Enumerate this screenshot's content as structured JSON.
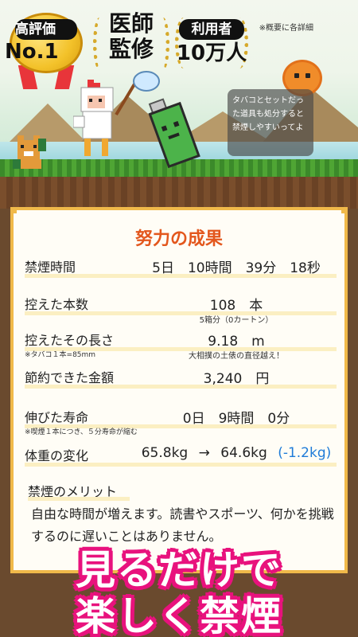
{
  "badges": {
    "rating": {
      "small": "高評価",
      "big": "No.1"
    },
    "medical": {
      "line1": "医師",
      "line2": "監修"
    },
    "users": {
      "small": "利用者",
      "big": "10万人"
    },
    "note": "※概要に各詳細"
  },
  "scene": {
    "speech": "タバコとセットだった道具も処分すると禁煙しやすいってよ",
    "icons": [
      "tiger-icon",
      "chicken-suit-character-icon",
      "net-icon",
      "lighter-character-icon",
      "sun-character-icon"
    ]
  },
  "card": {
    "title": "努力の成果",
    "rows": [
      {
        "label": "禁煙時間",
        "value": "5日　10時間　39分　18秒"
      },
      {
        "label": "控えた本数",
        "value": "108　本",
        "sub": "5箱分（0カートン）"
      },
      {
        "label": "控えたその長さ",
        "value": "9.18　m",
        "note": "※タバコ１本=85mm",
        "sub": "大相撲の土俵の直径越え！"
      },
      {
        "label": "節約できた金額",
        "value": "3,240　円"
      },
      {
        "label": "伸びた寿命",
        "value": "0日　9時間　0分",
        "note": "※喫煙１本につき、５分寿命が縮む"
      },
      {
        "label": "体重の変化",
        "value_from": "65.8kg",
        "arrow": "→",
        "value_to": "64.6kg",
        "diff": "(-1.2kg)"
      }
    ],
    "merit_title": "禁煙のメリット",
    "merit_text": "自由な時間が増えます。読書やスポーツ、何かを挑戦するのに遅いことはありません。"
  },
  "promo": {
    "line1": "見るだけで",
    "line2": "楽しく禁煙"
  },
  "colors": {
    "accent": "#e3571d",
    "card_border": "#f0b94a",
    "promo": "#e8127d",
    "diff": "#1e7bd8"
  }
}
